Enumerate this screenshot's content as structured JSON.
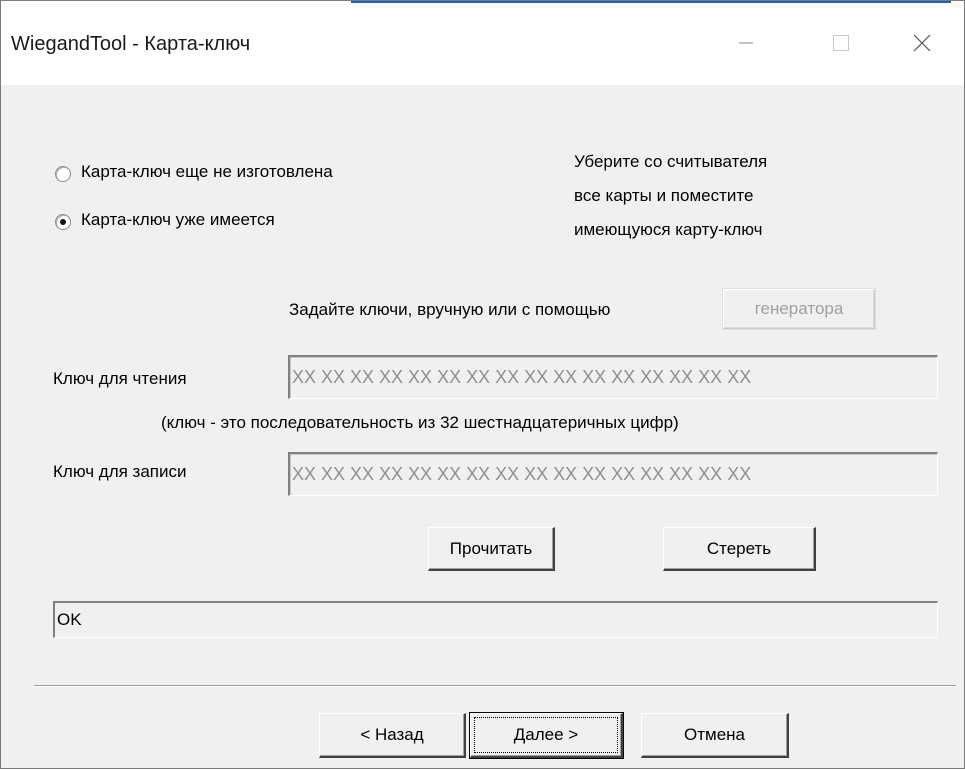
{
  "window": {
    "title": "WiegandTool - Карта-ключ",
    "accent_color": "#1f5fb4"
  },
  "radios": [
    {
      "label": "Карта-ключ еще не изготовлена",
      "selected": false
    },
    {
      "label": "Карта-ключ уже имеется",
      "selected": true
    }
  ],
  "instructions": {
    "line1": "Уберите со считывателя",
    "line2": "все карты и поместите",
    "line3": "имеющуюся карту-ключ"
  },
  "keys_prompt": "Задайте ключи, вручную или с помощью",
  "generator_button": "генератора",
  "read_key": {
    "label": "Ключ для чтения",
    "value": "XX XX XX XX XX XX XX XX XX XX XX XX XX XX XX XX"
  },
  "key_hint": "(ключ - это последовательность из 32 шестнадцатеричных цифр)",
  "write_key": {
    "label": "Ключ для записи",
    "value": "XX XX XX XX XX XX XX XX XX XX XX XX XX XX XX XX"
  },
  "actions": {
    "read": "Прочитать",
    "erase": "Стереть"
  },
  "status": "OK",
  "nav": {
    "back": "< Назад",
    "next": "Далее >",
    "cancel": "Отмена"
  },
  "icons": {
    "minimize": "minimize-icon",
    "maximize": "maximize-icon",
    "close": "close-icon"
  }
}
